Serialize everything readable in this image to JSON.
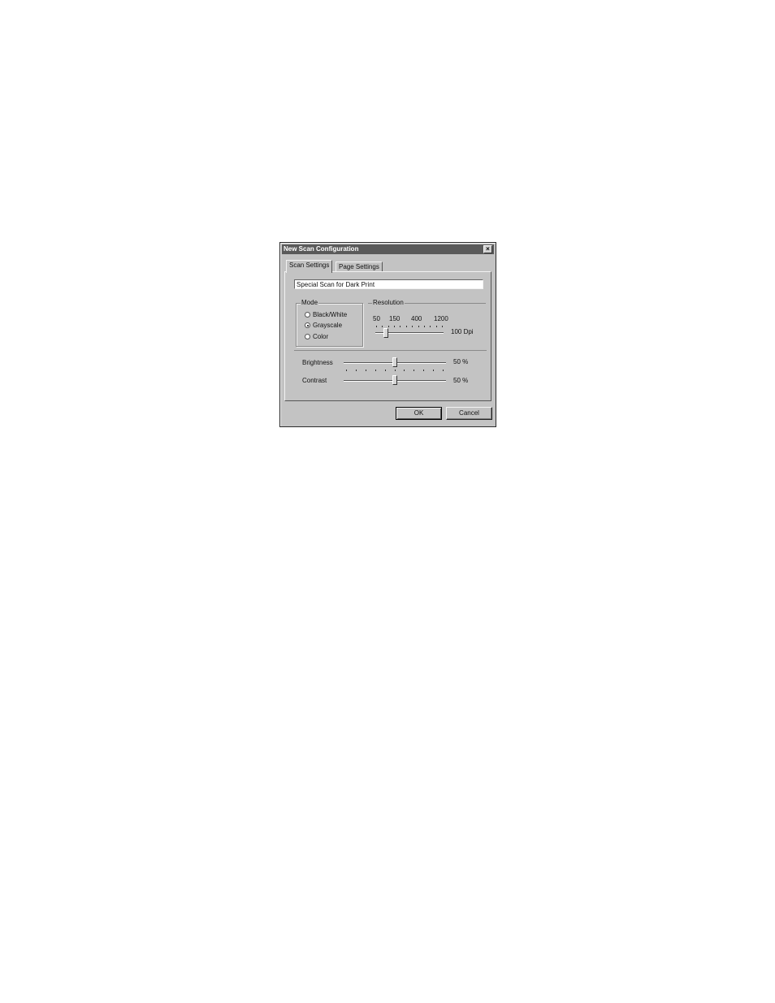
{
  "dialog": {
    "title": "New Scan Configuration",
    "close_glyph": "×",
    "tabs": [
      {
        "label": "Scan Settings",
        "active": true
      },
      {
        "label": "Page Settings",
        "active": false
      }
    ],
    "name_value": "Special Scan for Dark Print",
    "mode": {
      "label": "Mode",
      "options": [
        {
          "label": "Black/White",
          "checked": false
        },
        {
          "label": "Grayscale",
          "checked": true
        },
        {
          "label": "Color",
          "checked": false
        }
      ]
    },
    "resolution": {
      "label": "Resolution",
      "tick_labels": [
        "50",
        "150",
        "400",
        "1200"
      ],
      "value_text": "100 Dpi",
      "level_fraction": 0.15
    },
    "brightness": {
      "label": "Brightness",
      "value_text": "50 %",
      "level_fraction": 0.5
    },
    "contrast": {
      "label": "Contrast",
      "value_text": "50 %",
      "level_fraction": 0.5
    },
    "buttons": {
      "ok": "OK",
      "cancel": "Cancel"
    }
  }
}
